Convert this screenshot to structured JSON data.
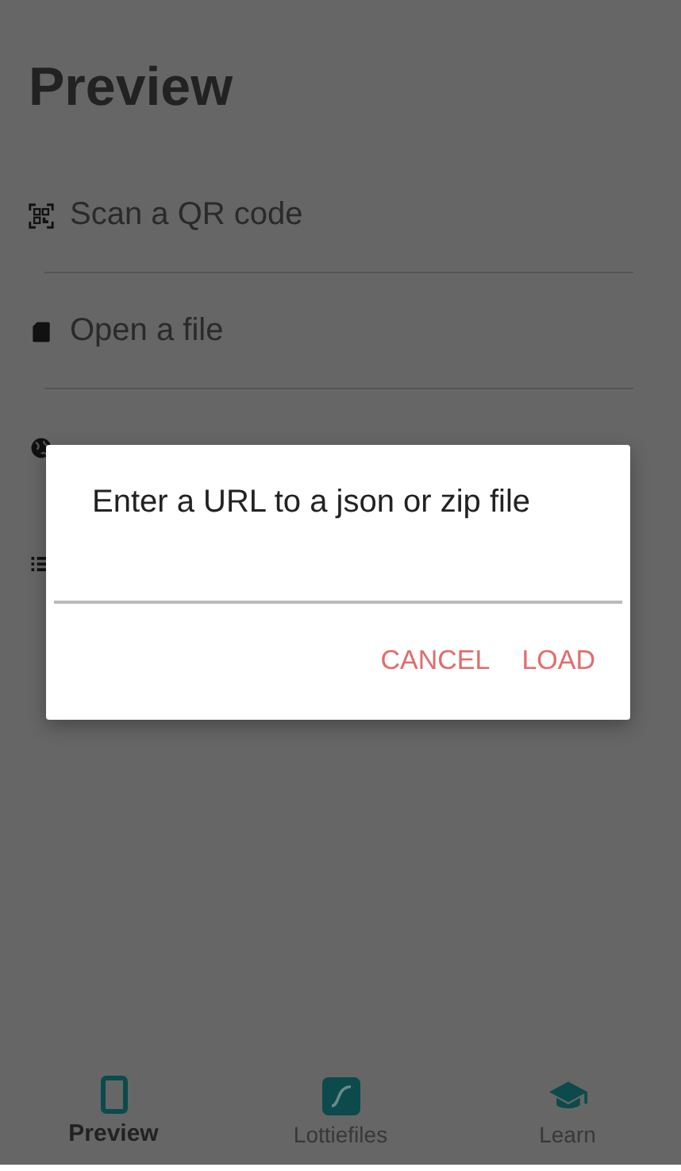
{
  "title": "Preview",
  "items": [
    {
      "kind": "qr",
      "label": "Scan a QR code"
    },
    {
      "kind": "file",
      "label": "Open a file"
    },
    {
      "kind": "globe"
    },
    {
      "kind": "list"
    }
  ],
  "dialog": {
    "title": "Enter a URL to a json or zip file",
    "buttons": [
      "CANCEL",
      "LOAD"
    ]
  },
  "tabs": [
    {
      "kind": "phone",
      "label": "Preview",
      "selected": true
    },
    {
      "kind": "lottie",
      "label": "Lottiefiles",
      "selected": false
    },
    {
      "kind": "learn",
      "label": "Learn",
      "selected": false
    }
  ]
}
